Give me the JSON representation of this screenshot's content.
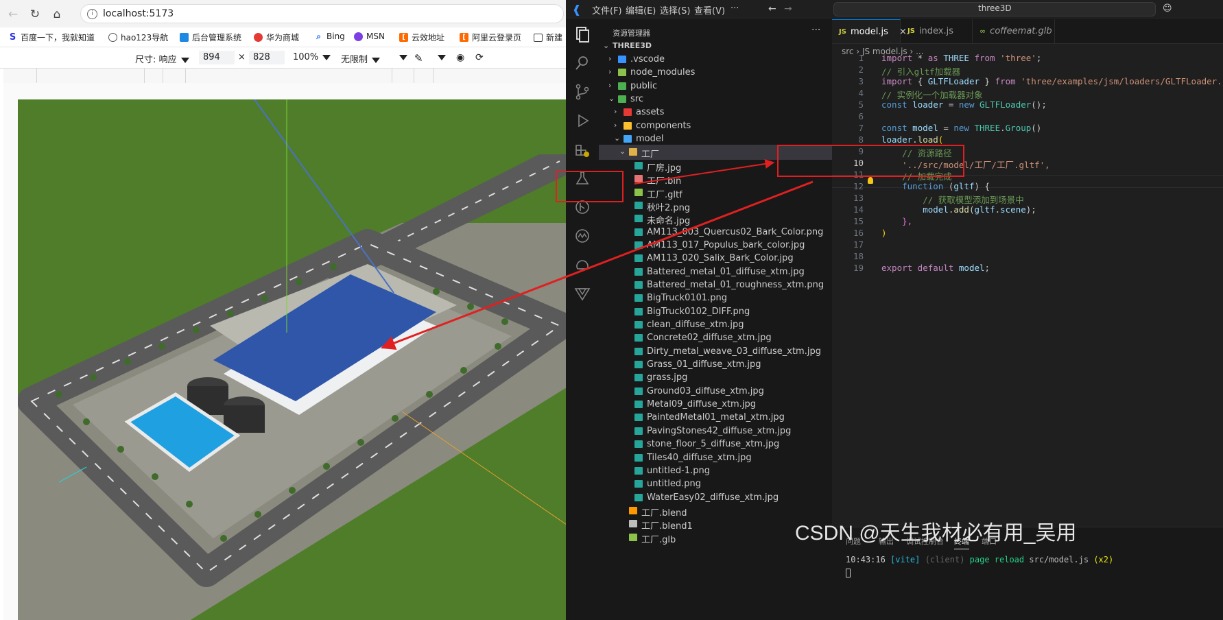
{
  "browser": {
    "url": "localhost:5173",
    "bookmarks": [
      "百度一下，我就知道",
      "hao123导航",
      "后台管理系统",
      "华为商城",
      "Bing",
      "MSN",
      "云效地址",
      "阿里云登录页",
      "新建"
    ],
    "device_toolbar": {
      "size_label": "尺寸: 响应",
      "width": "894",
      "times": "×",
      "height": "828",
      "zoom": "100%",
      "throttle": "无限制"
    }
  },
  "vscode": {
    "menus": [
      "文件(F)",
      "编辑(E)",
      "选择(S)",
      "查看(V)",
      "···"
    ],
    "command_center": "three3D",
    "explorer": {
      "title": "资源管理器",
      "root": "THREE3D",
      "items": [
        {
          "label": ".vscode",
          "depth": 1,
          "chev": "›",
          "color": "#3794ff"
        },
        {
          "label": "node_modules",
          "depth": 1,
          "chev": "›",
          "color": "#8bc34a"
        },
        {
          "label": "public",
          "depth": 1,
          "chev": "›",
          "color": "#4caf50"
        },
        {
          "label": "src",
          "depth": 1,
          "chev": "⌄",
          "color": "#4caf50"
        },
        {
          "label": "assets",
          "depth": 2,
          "chev": "›",
          "color": "#e53935"
        },
        {
          "label": "components",
          "depth": 2,
          "chev": "›",
          "color": "#fbc02d"
        },
        {
          "label": "model",
          "depth": 2,
          "chev": "⌄",
          "color": "#42a5f5"
        },
        {
          "label": "工厂",
          "depth": 3,
          "chev": "⌄",
          "color": "#e0b04a",
          "selected": true
        },
        {
          "label": "厂房.jpg",
          "depth": 4,
          "color": "#26a69a"
        },
        {
          "label": "工厂.bin",
          "depth": 4,
          "color": "#e57373"
        },
        {
          "label": "工厂.gltf",
          "depth": 4,
          "color": "#8bc34a"
        },
        {
          "label": "秋叶2.png",
          "depth": 4,
          "color": "#26a69a"
        },
        {
          "label": "未命名.jpg",
          "depth": 4,
          "color": "#26a69a"
        },
        {
          "label": "AM113_003_Quercus02_Bark_Color.png",
          "depth": 4,
          "color": "#26a69a"
        },
        {
          "label": "AM113_017_Populus_bark_color.jpg",
          "depth": 4,
          "color": "#26a69a"
        },
        {
          "label": "AM113_020_Salix_Bark_Color.jpg",
          "depth": 4,
          "color": "#26a69a"
        },
        {
          "label": "Battered_metal_01_diffuse_xtm.jpg",
          "depth": 4,
          "color": "#26a69a"
        },
        {
          "label": "Battered_metal_01_roughness_xtm.png",
          "depth": 4,
          "color": "#26a69a"
        },
        {
          "label": "BigTruck0101.png",
          "depth": 4,
          "color": "#26a69a"
        },
        {
          "label": "BigTruck0102_DIFF.png",
          "depth": 4,
          "color": "#26a69a"
        },
        {
          "label": "clean_diffuse_xtm.jpg",
          "depth": 4,
          "color": "#26a69a"
        },
        {
          "label": "Concrete02_diffuse_xtm.jpg",
          "depth": 4,
          "color": "#26a69a"
        },
        {
          "label": "Dirty_metal_weave_03_diffuse_xtm.jpg",
          "depth": 4,
          "color": "#26a69a"
        },
        {
          "label": "Grass_01_diffuse_xtm.jpg",
          "depth": 4,
          "color": "#26a69a"
        },
        {
          "label": "grass.jpg",
          "depth": 4,
          "color": "#26a69a"
        },
        {
          "label": "Ground03_diffuse_xtm.jpg",
          "depth": 4,
          "color": "#26a69a"
        },
        {
          "label": "Metal09_diffuse_xtm.jpg",
          "depth": 4,
          "color": "#26a69a"
        },
        {
          "label": "PaintedMetal01_metal_xtm.jpg",
          "depth": 4,
          "color": "#26a69a"
        },
        {
          "label": "PavingStones42_diffuse_xtm.jpg",
          "depth": 4,
          "color": "#26a69a"
        },
        {
          "label": "stone_floor_5_diffuse_xtm.jpg",
          "depth": 4,
          "color": "#26a69a"
        },
        {
          "label": "Tiles40_diffuse_xtm.jpg",
          "depth": 4,
          "color": "#26a69a"
        },
        {
          "label": "untitled-1.png",
          "depth": 4,
          "color": "#26a69a"
        },
        {
          "label": "untitled.png",
          "depth": 4,
          "color": "#26a69a"
        },
        {
          "label": "WaterEasy02_diffuse_xtm.jpg",
          "depth": 4,
          "color": "#26a69a"
        },
        {
          "label": "工厂.blend",
          "depth": 3,
          "color": "#ff9800"
        },
        {
          "label": "工厂.blend1",
          "depth": 3,
          "color": "#bdbdbd"
        },
        {
          "label": "工厂.glb",
          "depth": 3,
          "color": "#8bc34a"
        }
      ]
    },
    "tabs": [
      {
        "label": "model.js",
        "active": true,
        "close": "×"
      },
      {
        "label": "index.js",
        "active": false
      },
      {
        "label": "coffeemat.glb",
        "active": false
      }
    ],
    "breadcrumb": "src › JS model.js › ...",
    "code_lines": [
      "1",
      "2",
      "3",
      "4",
      "5",
      "6",
      "7",
      "8",
      "9",
      "10",
      "11",
      "12",
      "13",
      "14",
      "15",
      "16",
      "17",
      "18",
      "19"
    ],
    "code": {
      "l1a": "import",
      "l1b": " * ",
      "l1c": "as",
      "l1d": " THREE ",
      "l1e": "from",
      "l1f": " 'three'",
      "l1g": ";",
      "l2": "// 引入gltf加载器",
      "l3a": "import",
      "l3b": " { ",
      "l3c": "GLTFLoader",
      "l3d": " } ",
      "l3e": "from",
      "l3f": " 'three/examples/jsm/loaders/GLTFLoader.js'",
      "l4": "// 实例化一个加载器对象",
      "l5a": "const",
      "l5b": " loader",
      "l5c": " = ",
      "l5d": "new",
      "l5e": " GLTFLoader",
      "l5f": "();",
      "l7a": "const",
      "l7b": " model",
      "l7c": " = ",
      "l7d": "new",
      "l7e": " THREE",
      "l7f": ".",
      "l7g": "Group",
      "l7h": "()",
      "l8a": "loader",
      "l8b": ".",
      "l8c": "load",
      "l8d": "(",
      "l9": "    // 资源路径",
      "l10": "    '../src/model/工厂/工厂.gltf',",
      "l11": "    // 加载完成",
      "l12a": "    function",
      "l12b": " (",
      "l12c": "gltf",
      "l12d": ") {",
      "l13": "        // 获取模型添加到场景中",
      "l14a": "        model",
      "l14b": ".",
      "l14c": "add",
      "l14d": "(",
      "l14e": "gltf",
      "l14f": ".",
      "l14g": "scene",
      "l14h": ");",
      "l15": "    },",
      "l16": ")",
      "l19a": "export",
      "l19b": " default",
      "l19c": " model",
      "l19d": ";"
    },
    "panel": {
      "tabs": [
        "问题",
        "输出",
        "调试控制台",
        "终端",
        "端口"
      ],
      "active_tab": "终端",
      "term_time": "10:43:16",
      "term_vite": "[vite]",
      "term_client": "(client)",
      "term_msg": "page reload",
      "term_path": "src/model.js",
      "term_count": "(x2)"
    }
  },
  "watermark": "CSDN @天生我材必有用_吴用",
  "colors": {
    "annotation_red": "#e02020",
    "grass": "#4f7d2a",
    "road": "#5a5a5a",
    "roof": "#2f56a8",
    "water": "#1fa0e0"
  }
}
